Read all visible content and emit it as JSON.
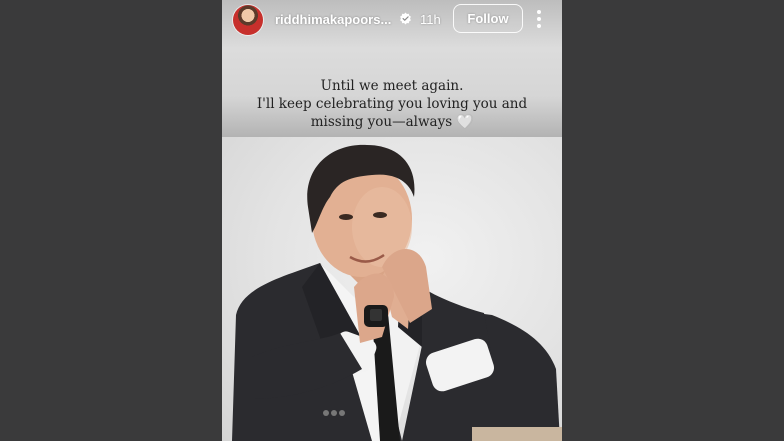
{
  "story": {
    "username": "riddhimakapoors...",
    "time_ago": "11h",
    "follow_label": "Follow",
    "caption_lines": [
      "Until we meet again.",
      "I'll keep celebrating you loving you and",
      "missing you—always"
    ],
    "caption_emoji": "🤍"
  },
  "icons": {
    "verified": "verified-badge-icon",
    "more": "more-vertical-icon"
  },
  "colors": {
    "page_background": "#3a3a3b",
    "story_text": "#222222",
    "header_text": "#ffffff"
  }
}
